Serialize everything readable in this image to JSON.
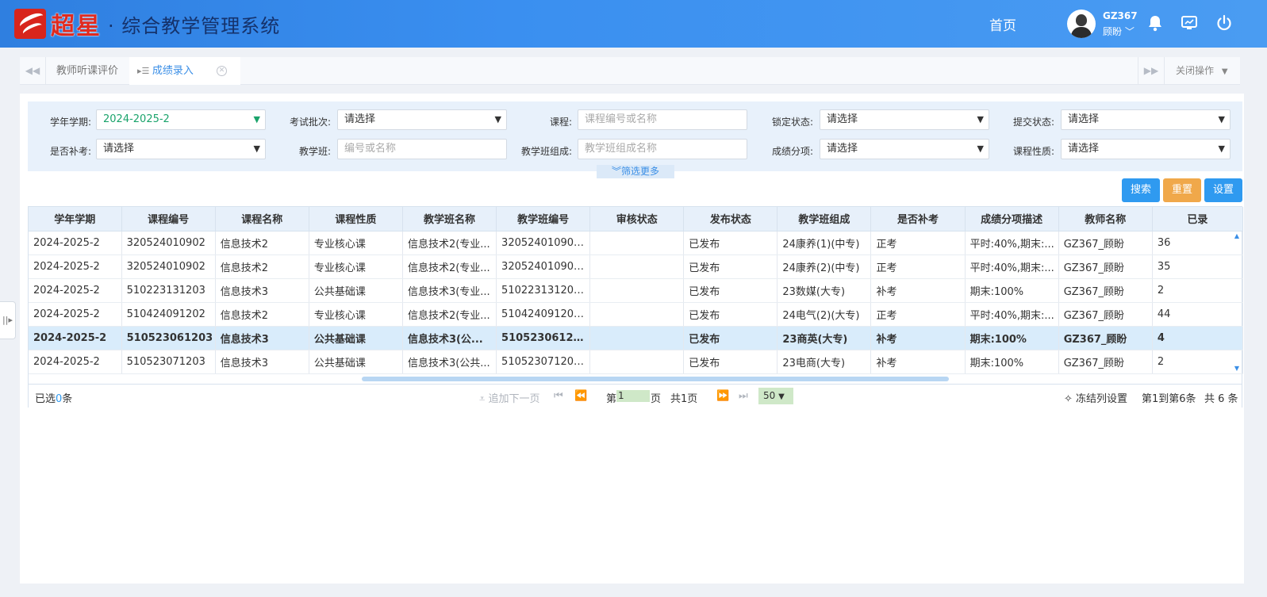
{
  "header": {
    "brand": "超星",
    "system_title": "· 综合教学管理系统",
    "nav_home": "首页",
    "user_id": "GZ367",
    "user_name": "顾盼",
    "icons": [
      "bell-icon",
      "monitor-icon",
      "power-icon"
    ]
  },
  "tabs": {
    "items": [
      {
        "label": "教师听课评价",
        "active": false
      },
      {
        "label": "成绩录入",
        "active": true
      }
    ],
    "close_ops": "关闭操作"
  },
  "filters": {
    "term_label": "学年学期:",
    "term_value": "2024-2025-2",
    "batch_label": "考试批次:",
    "batch_value": "请选择",
    "course_label": "课程:",
    "course_placeholder": "课程编号或名称",
    "lock_label": "锁定状态:",
    "lock_value": "请选择",
    "submit_label": "提交状态:",
    "submit_value": "请选择",
    "makeup_label": "是否补考:",
    "makeup_value": "请选择",
    "class_label": "教学班:",
    "class_placeholder": "编号或名称",
    "composition_label": "教学班组成:",
    "composition_placeholder": "教学班组成名称",
    "score_item_label": "成绩分项:",
    "score_item_value": "请选择",
    "course_type_label": "课程性质:",
    "course_type_value": "请选择",
    "more": "筛选更多"
  },
  "buttons": {
    "search": "搜索",
    "reset": "重置",
    "settings": "设置"
  },
  "table": {
    "columns": [
      "学年学期",
      "课程编号",
      "课程名称",
      "课程性质",
      "教学班名称",
      "教学班编号",
      "审核状态",
      "发布状态",
      "教学班组成",
      "是否补考",
      "成绩分项描述",
      "教师名称",
      "已录"
    ],
    "rows": [
      [
        "2024-2025-2",
        "320524010902",
        "信息技术2",
        "专业核心课",
        "信息技术2(专业...",
        "320524010902...",
        "",
        "已发布",
        "24康养(1)(中专)",
        "正考",
        "平时:40%,期末:...",
        "GZ367_顾盼",
        "36"
      ],
      [
        "2024-2025-2",
        "320524010902",
        "信息技术2",
        "专业核心课",
        "信息技术2(专业...",
        "320524010902...",
        "",
        "已发布",
        "24康养(2)(中专)",
        "正考",
        "平时:40%,期末:...",
        "GZ367_顾盼",
        "35"
      ],
      [
        "2024-2025-2",
        "510223131203",
        "信息技术3",
        "公共基础课",
        "信息技术3(专业...",
        "510223131203...",
        "",
        "已发布",
        "23数媒(大专)",
        "补考",
        "期末:100%",
        "GZ367_顾盼",
        "2"
      ],
      [
        "2024-2025-2",
        "510424091202",
        "信息技术2",
        "专业核心课",
        "信息技术2(专业...",
        "510424091202...",
        "",
        "已发布",
        "24电气(2)(大专)",
        "正考",
        "平时:40%,期末:...",
        "GZ367_顾盼",
        "44"
      ],
      [
        "2024-2025-2",
        "510523061203",
        "信息技术3",
        "公共基础课",
        "信息技术3(公...",
        "51052306120...",
        "",
        "已发布",
        "23商英(大专)",
        "补考",
        "期末:100%",
        "GZ367_顾盼",
        "4"
      ],
      [
        "2024-2025-2",
        "510523071203",
        "信息技术3",
        "公共基础课",
        "信息技术3(公共...",
        "510523071203...",
        "",
        "已发布",
        "23电商(大专)",
        "补考",
        "期末:100%",
        "GZ367_顾盼",
        "2"
      ]
    ],
    "selected_row": 4
  },
  "pager": {
    "selected_prefix": "已选",
    "selected_count": "0",
    "selected_suffix": "条",
    "append_next": "追加下一页",
    "page_prefix": "第",
    "page_value": "1",
    "page_suffix": "页",
    "total_pages": "共1页",
    "page_size": "50",
    "freeze": "冻结列设置",
    "range": "第1到第6条",
    "total": "共 6 条"
  }
}
